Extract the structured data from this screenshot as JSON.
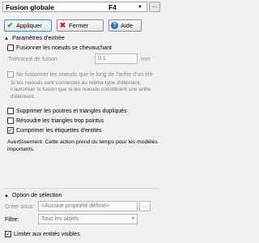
{
  "window": {
    "title": "Fusion globale",
    "shortcut": "F4",
    "more_label": "..."
  },
  "toolbar": {
    "apply_label": "Appliquer",
    "close_label": "Fermer",
    "help_label": "Aide"
  },
  "input_params": {
    "title": "Paramètres d'entrée",
    "merge_overlapping_label": "Fusionner les noeuds se chevauchant",
    "tolerance_label": "Tolérance de fusion",
    "tolerance_value": "0.1",
    "tolerance_unit": "mm",
    "edge_merge_label": "Ne fusionner les noeuds que le long de l'arête d'un élé",
    "edge_merge_note": "Si les noeuds sont connectés au même type d'élément, n'autoriser la fusion que si les noeuds constituent une arête d'élément.",
    "delete_duplicates_label": "Supprimer les poutres et triangles dupliqués",
    "resolve_pointed_label": "Résoudre les triangles trop pointus",
    "compress_labels_label": "Comprimer les étiquettes d'entités",
    "warning": "Avertissement: Cette action prend du temps pour les modèles importants."
  },
  "selection": {
    "title": "Option de sélection",
    "create_under_label": "Créer sous:",
    "create_under_value": "<Aucune propriété définie>",
    "filter_label": "Filtre:",
    "filter_value": "Tous les objets",
    "limit_visible_label": "Limiter aux entités visibles"
  },
  "state": {
    "merge_overlapping": false,
    "edge_merge": false,
    "delete_duplicates": false,
    "resolve_pointed": false,
    "compress_labels": true,
    "limit_visible": true
  }
}
